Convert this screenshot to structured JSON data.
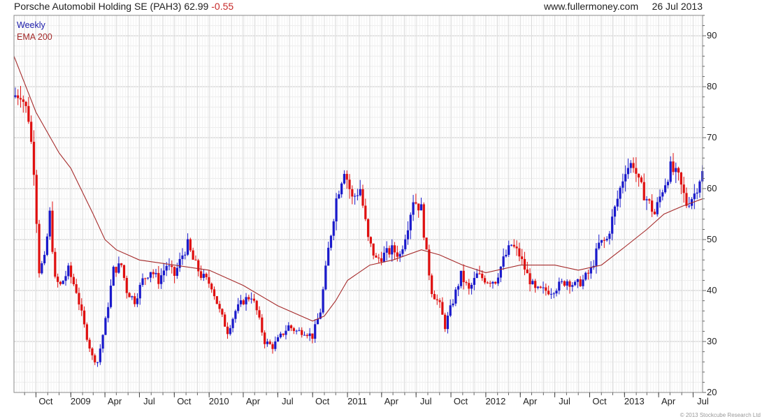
{
  "header": {
    "instrument": "Porsche Automobil Holding SE (PAH3)",
    "last": "62.99",
    "change": "-0.55",
    "site": "www.fullermoney.com",
    "date": "26 Jul 2013"
  },
  "legend": {
    "period": "Weekly",
    "ema": "EMA 200"
  },
  "footer": "© 2013 Stockcube Research Ltd",
  "colors": {
    "up": "#1a1acc",
    "down": "#e01010",
    "ema": "#a52a2a",
    "grid": "#dcdcdc"
  },
  "chart_data": {
    "type": "candlestick",
    "frequency": "weekly",
    "x_range": [
      "2008-08-04",
      "2013-07-26"
    ],
    "ylim": [
      20,
      94
    ],
    "yticks": [
      20,
      30,
      40,
      50,
      60,
      70,
      80,
      90
    ],
    "x_tick_labels": [
      {
        "label": "Oct",
        "date": "2008-10-01"
      },
      {
        "label": "2009",
        "date": "2009-01-01"
      },
      {
        "label": "Apr",
        "date": "2009-04-01"
      },
      {
        "label": "Jul",
        "date": "2009-07-01"
      },
      {
        "label": "Oct",
        "date": "2009-10-01"
      },
      {
        "label": "2010",
        "date": "2010-01-01"
      },
      {
        "label": "Apr",
        "date": "2010-04-01"
      },
      {
        "label": "Jul",
        "date": "2010-07-01"
      },
      {
        "label": "Oct",
        "date": "2010-10-01"
      },
      {
        "label": "2011",
        "date": "2011-01-01"
      },
      {
        "label": "Apr",
        "date": "2011-04-01"
      },
      {
        "label": "Jul",
        "date": "2011-07-01"
      },
      {
        "label": "Oct",
        "date": "2011-10-01"
      },
      {
        "label": "2012",
        "date": "2012-01-01"
      },
      {
        "label": "Apr",
        "date": "2012-04-01"
      },
      {
        "label": "Jul",
        "date": "2012-07-01"
      },
      {
        "label": "Oct",
        "date": "2012-10-01"
      },
      {
        "label": "2013",
        "date": "2013-01-01"
      },
      {
        "label": "Apr",
        "date": "2013-04-01"
      },
      {
        "label": "Jul",
        "date": "2013-07-01"
      }
    ],
    "price_path": [
      [
        "2008-08-04",
        78
      ],
      [
        "2008-08-25",
        79
      ],
      [
        "2008-09-15",
        74
      ],
      [
        "2008-09-29",
        64
      ],
      [
        "2008-10-13",
        44
      ],
      [
        "2008-10-27",
        46
      ],
      [
        "2008-11-10",
        55
      ],
      [
        "2008-11-24",
        42
      ],
      [
        "2008-12-08",
        41
      ],
      [
        "2008-12-29",
        44
      ],
      [
        "2009-01-19",
        40
      ],
      [
        "2009-02-09",
        33
      ],
      [
        "2009-03-02",
        27
      ],
      [
        "2009-03-16",
        26
      ],
      [
        "2009-04-06",
        34
      ],
      [
        "2009-04-27",
        44
      ],
      [
        "2009-05-18",
        45
      ],
      [
        "2009-06-01",
        40
      ],
      [
        "2009-06-22",
        38
      ],
      [
        "2009-07-13",
        42
      ],
      [
        "2009-08-03",
        44
      ],
      [
        "2009-08-24",
        42
      ],
      [
        "2009-09-14",
        45
      ],
      [
        "2009-10-05",
        43
      ],
      [
        "2009-10-26",
        47
      ],
      [
        "2009-11-09",
        49
      ],
      [
        "2009-11-23",
        46
      ],
      [
        "2009-12-14",
        43
      ],
      [
        "2010-01-11",
        41
      ],
      [
        "2010-02-01",
        36
      ],
      [
        "2010-02-22",
        32
      ],
      [
        "2010-03-15",
        36
      ],
      [
        "2010-04-05",
        38
      ],
      [
        "2010-04-26",
        39
      ],
      [
        "2010-05-10",
        36
      ],
      [
        "2010-05-31",
        30
      ],
      [
        "2010-06-21",
        29
      ],
      [
        "2010-07-12",
        31
      ],
      [
        "2010-08-02",
        33
      ],
      [
        "2010-08-23",
        32
      ],
      [
        "2010-09-13",
        32
      ],
      [
        "2010-10-04",
        31
      ],
      [
        "2010-10-25",
        36
      ],
      [
        "2010-11-15",
        48
      ],
      [
        "2010-12-06",
        58
      ],
      [
        "2010-12-27",
        64
      ],
      [
        "2011-01-17",
        58
      ],
      [
        "2011-02-07",
        60
      ],
      [
        "2011-02-28",
        50
      ],
      [
        "2011-03-21",
        46
      ],
      [
        "2011-04-11",
        47
      ],
      [
        "2011-05-02",
        48
      ],
      [
        "2011-05-23",
        47
      ],
      [
        "2011-06-13",
        53
      ],
      [
        "2011-06-27",
        58
      ],
      [
        "2011-07-18",
        56
      ],
      [
        "2011-08-01",
        47
      ],
      [
        "2011-08-15",
        40
      ],
      [
        "2011-09-05",
        37
      ],
      [
        "2011-09-19",
        33
      ],
      [
        "2011-10-10",
        38
      ],
      [
        "2011-10-31",
        43
      ],
      [
        "2011-11-21",
        40
      ],
      [
        "2011-12-12",
        43
      ],
      [
        "2012-01-09",
        42
      ],
      [
        "2012-01-30",
        42
      ],
      [
        "2012-02-20",
        46
      ],
      [
        "2012-03-12",
        49
      ],
      [
        "2012-04-02",
        47
      ],
      [
        "2012-04-23",
        43
      ],
      [
        "2012-05-14",
        40
      ],
      [
        "2012-06-04",
        40
      ],
      [
        "2012-06-25",
        40
      ],
      [
        "2012-07-16",
        41
      ],
      [
        "2012-08-06",
        42
      ],
      [
        "2012-08-27",
        41
      ],
      [
        "2012-09-17",
        42
      ],
      [
        "2012-10-08",
        44
      ],
      [
        "2012-10-29",
        49
      ],
      [
        "2012-11-19",
        50
      ],
      [
        "2012-12-10",
        56
      ],
      [
        "2013-01-07",
        64
      ],
      [
        "2013-01-28",
        65
      ],
      [
        "2013-02-11",
        61
      ],
      [
        "2013-03-04",
        58
      ],
      [
        "2013-03-25",
        55
      ],
      [
        "2013-04-15",
        60
      ],
      [
        "2013-05-06",
        64
      ],
      [
        "2013-05-27",
        62
      ],
      [
        "2013-06-17",
        57
      ],
      [
        "2013-07-08",
        59
      ],
      [
        "2013-07-26",
        63
      ]
    ],
    "ema_path": [
      [
        "2008-08-04",
        86
      ],
      [
        "2008-10-01",
        75
      ],
      [
        "2008-12-01",
        67
      ],
      [
        "2009-01-01",
        64
      ],
      [
        "2009-03-01",
        55
      ],
      [
        "2009-04-01",
        50
      ],
      [
        "2009-05-01",
        48
      ],
      [
        "2009-07-01",
        46
      ],
      [
        "2009-10-01",
        45
      ],
      [
        "2010-01-01",
        44
      ],
      [
        "2010-04-01",
        41
      ],
      [
        "2010-07-01",
        37
      ],
      [
        "2010-10-01",
        34
      ],
      [
        "2010-11-01",
        35
      ],
      [
        "2010-12-01",
        38
      ],
      [
        "2011-01-01",
        42
      ],
      [
        "2011-03-01",
        45
      ],
      [
        "2011-05-01",
        46
      ],
      [
        "2011-07-15",
        48
      ],
      [
        "2011-09-01",
        47
      ],
      [
        "2011-11-01",
        45
      ],
      [
        "2012-01-01",
        43.5
      ],
      [
        "2012-04-01",
        45
      ],
      [
        "2012-07-01",
        45
      ],
      [
        "2012-09-01",
        44
      ],
      [
        "2012-11-01",
        45
      ],
      [
        "2013-01-01",
        48.5
      ],
      [
        "2013-03-01",
        52
      ],
      [
        "2013-04-15",
        55
      ],
      [
        "2013-06-01",
        56.5
      ],
      [
        "2013-07-26",
        58
      ]
    ]
  }
}
